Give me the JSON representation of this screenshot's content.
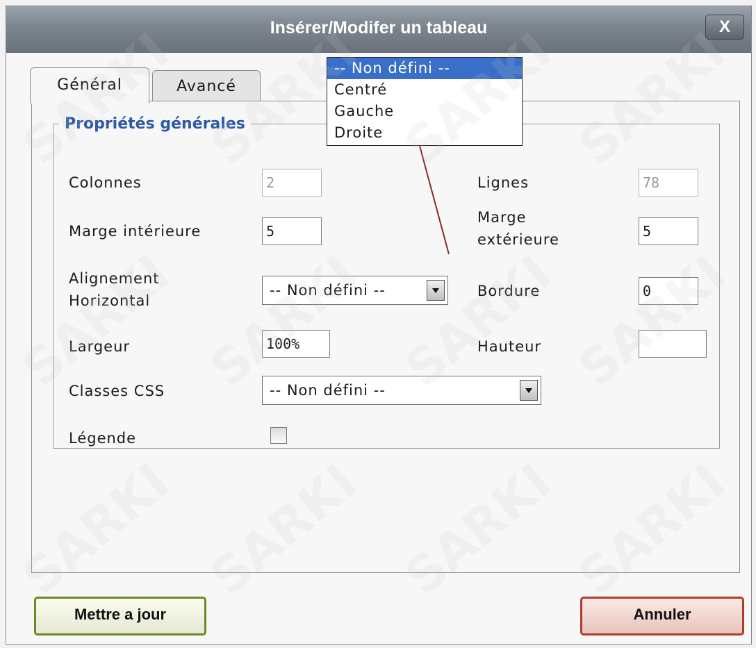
{
  "dialog": {
    "title": "Insérer/Modifer un tableau",
    "close_label": "X"
  },
  "tabs": [
    {
      "label": "Général",
      "active": true
    },
    {
      "label": "Avancé",
      "active": false
    }
  ],
  "section": {
    "legend": "Propriétés générales"
  },
  "fields": {
    "colonnes": {
      "label": "Colonnes",
      "value": "2"
    },
    "lignes": {
      "label": "Lignes",
      "value": "78"
    },
    "marge_interieure": {
      "label": "Marge intérieure",
      "value": "5"
    },
    "marge_exterieure": {
      "label_line1": "Marge",
      "label_line2": "extérieure",
      "value": "5"
    },
    "alignement": {
      "label_line1": "Alignement",
      "label_line2": "Horizontal",
      "value": "-- Non défini --"
    },
    "bordure": {
      "label": "Bordure",
      "value": "0"
    },
    "largeur": {
      "label": "Largeur",
      "value": "100%"
    },
    "hauteur": {
      "label": "Hauteur",
      "value": ""
    },
    "classes_css": {
      "label": "Classes CSS",
      "value": "-- Non défini --"
    },
    "legende": {
      "label": "Légende",
      "checked": false
    }
  },
  "dropdown": {
    "options": [
      "-- Non défini --",
      "Centré",
      "Gauche",
      "Droite"
    ],
    "selected_index": 0
  },
  "buttons": {
    "update": "Mettre a jour",
    "cancel": "Annuler"
  },
  "watermark": {
    "text": "SARKI"
  },
  "colors": {
    "titlebar": "#7c848d",
    "legend": "#2a5aa8",
    "selection": "#3a6fc9",
    "update_border": "#6a8a22",
    "cancel_border": "#b23a2a",
    "connector": "#8b2a2a"
  }
}
